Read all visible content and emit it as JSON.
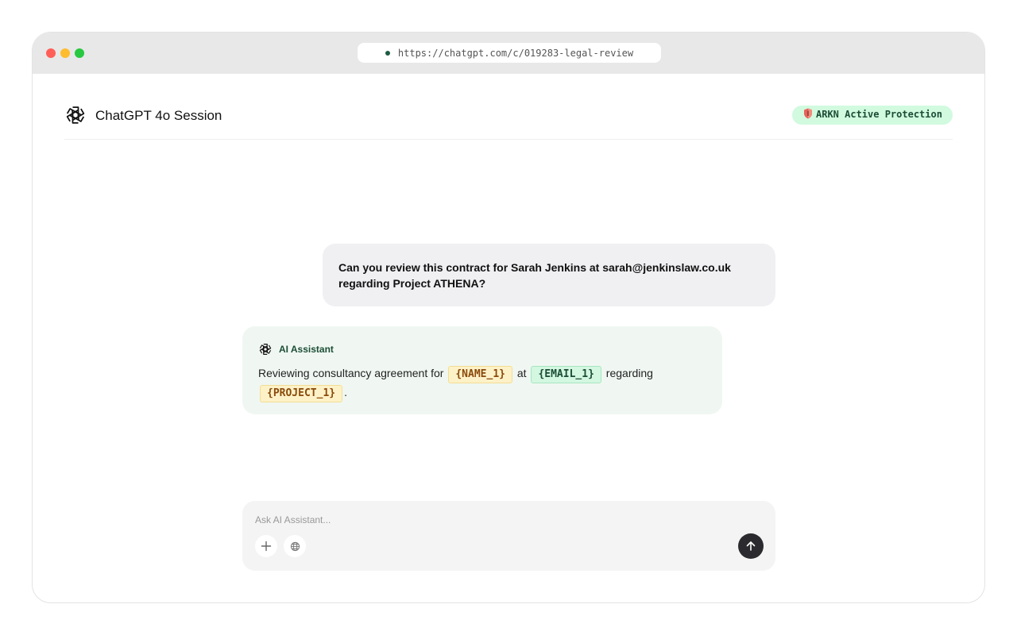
{
  "browser": {
    "url": "https://chatgpt.com/c/019283-legal-review"
  },
  "header": {
    "title": "ChatGPT 4o Session",
    "badge": "ARKN Active Protection"
  },
  "conversation": {
    "user_message": "Can you review this contract for Sarah Jenkins at sarah@jenkinslaw.co.uk regarding Project ATHENA?",
    "assistant": {
      "name": "AI Assistant",
      "text_before": "Reviewing consultancy agreement for",
      "token_name": "{NAME_1}",
      "text_at": "at",
      "token_email": "{EMAIL_1}",
      "text_regarding": "regarding",
      "token_project": "{PROJECT_1}",
      "text_end": "."
    }
  },
  "composer": {
    "placeholder": "Ask AI Assistant..."
  },
  "colors": {
    "accent_green": "#1b4d36",
    "badge_bg": "#d1fadf",
    "token_yellow": "#fdf1c7",
    "token_green": "#d3f7e0",
    "send_button": "#2b2b2f"
  },
  "icons": [
    "chatgpt-logo-icon",
    "shield-icon",
    "plus-icon",
    "globe-icon",
    "arrow-up-icon"
  ]
}
